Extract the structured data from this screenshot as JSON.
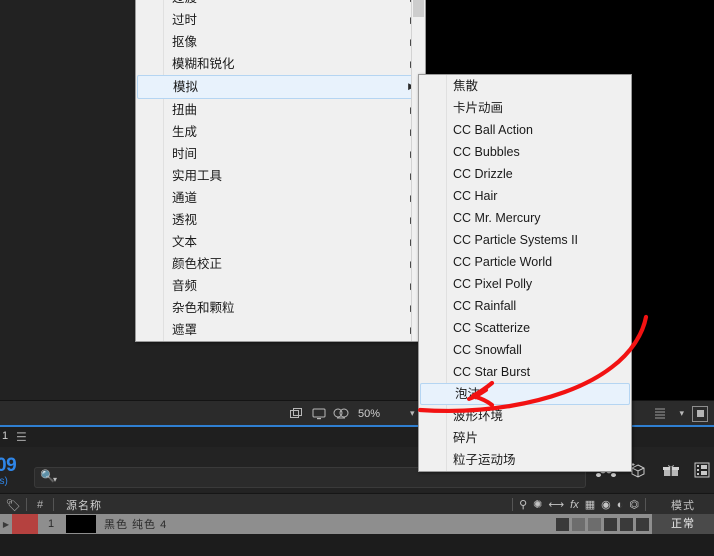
{
  "app": {
    "viewer": {
      "zoom_level": "50%",
      "icons": [
        "render-region-icon",
        "monitor-icon",
        "mask-view-icon"
      ],
      "caret": "chevron-down-icon"
    },
    "timeline": {
      "tab_number": "1",
      "panel_menu_icon": "hamburger-menu-icon",
      "timecode": "09",
      "fps_label": "ps)",
      "search_placeholder": "",
      "search_icon": "search-icon",
      "right_icons": [
        "puppet-tool-icon",
        "3d-camera-icon",
        "gift-icon",
        "film-strip-icon"
      ]
    },
    "layers": {
      "headers": {
        "tag": "label-tag-icon",
        "number": "#",
        "source_name": "源名称",
        "mode": "模式",
        "switch_icons": [
          "shy-icon",
          "effects-icon",
          "motion-blur-icon",
          "fx-icon",
          "adjustment-icon",
          "collapse-icon",
          "quality-icon",
          "3d-icon"
        ]
      },
      "rows": [
        {
          "index": "1",
          "name": "黑色 纯色 4",
          "mode": "正常",
          "label_color": "#b5413f"
        }
      ]
    }
  },
  "menus": {
    "effects_menu": {
      "name": "effect-category-menu",
      "items": [
        {
          "label": "过渡",
          "has_submenu": true,
          "selected": false,
          "clipped": true
        },
        {
          "label": "过时",
          "has_submenu": true,
          "selected": false
        },
        {
          "label": "抠像",
          "has_submenu": true,
          "selected": false
        },
        {
          "label": "模糊和锐化",
          "has_submenu": true,
          "selected": false
        },
        {
          "label": "模拟",
          "has_submenu": true,
          "selected": true
        },
        {
          "label": "扭曲",
          "has_submenu": true,
          "selected": false
        },
        {
          "label": "生成",
          "has_submenu": true,
          "selected": false
        },
        {
          "label": "时间",
          "has_submenu": true,
          "selected": false
        },
        {
          "label": "实用工具",
          "has_submenu": true,
          "selected": false
        },
        {
          "label": "通道",
          "has_submenu": true,
          "selected": false
        },
        {
          "label": "透视",
          "has_submenu": true,
          "selected": false
        },
        {
          "label": "文本",
          "has_submenu": true,
          "selected": false
        },
        {
          "label": "颜色校正",
          "has_submenu": true,
          "selected": false
        },
        {
          "label": "音频",
          "has_submenu": true,
          "selected": false
        },
        {
          "label": "杂色和颗粒",
          "has_submenu": true,
          "selected": false
        },
        {
          "label": "遮罩",
          "has_submenu": true,
          "selected": false
        }
      ]
    },
    "simulation_submenu": {
      "name": "simulation-effects-submenu",
      "items": [
        {
          "label": "焦散",
          "selected": false
        },
        {
          "label": "卡片动画",
          "selected": false
        },
        {
          "label": "CC Ball Action",
          "selected": false
        },
        {
          "label": "CC Bubbles",
          "selected": false
        },
        {
          "label": "CC Drizzle",
          "selected": false
        },
        {
          "label": "CC Hair",
          "selected": false
        },
        {
          "label": "CC Mr. Mercury",
          "selected": false
        },
        {
          "label": "CC Particle Systems II",
          "selected": false
        },
        {
          "label": "CC Particle World",
          "selected": false
        },
        {
          "label": "CC Pixel Polly",
          "selected": false
        },
        {
          "label": "CC Rainfall",
          "selected": false
        },
        {
          "label": "CC Scatterize",
          "selected": false
        },
        {
          "label": "CC Snowfall",
          "selected": false
        },
        {
          "label": "CC Star Burst",
          "selected": false
        },
        {
          "label": "泡沫",
          "selected": true
        },
        {
          "label": "波形环境",
          "selected": false
        },
        {
          "label": "碎片",
          "selected": false
        },
        {
          "label": "粒子运动场",
          "selected": false
        }
      ]
    }
  },
  "annotation": {
    "name": "red-arrow-annotation",
    "color": "#f01010",
    "points_to": "泡沫"
  },
  "colors": {
    "menu_background": "#f0f0f0",
    "menu_selected_bg": "#e8f2fc",
    "menu_selected_border": "#b5d5f2",
    "panel_background": "#222222",
    "accent_blue": "#2f86e8",
    "layer_row": "#8e8e8e"
  }
}
